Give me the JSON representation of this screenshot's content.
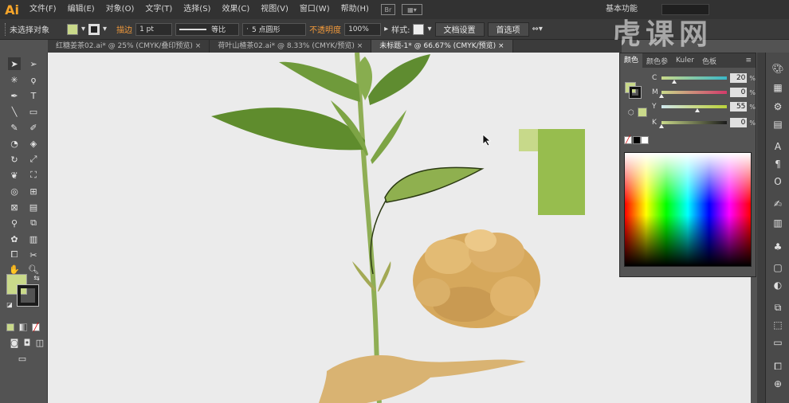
{
  "app": {
    "logo": "Ai"
  },
  "menu": [
    "文件(F)",
    "编辑(E)",
    "对象(O)",
    "文字(T)",
    "选择(S)",
    "效果(C)",
    "视图(V)",
    "窗口(W)",
    "帮助(H)"
  ],
  "menu_extra": {
    "bridge": "Br"
  },
  "workspace": "基本功能",
  "watermark": "虎课网",
  "control_bar": {
    "selection": "未选择对象",
    "fill_color": "#c9d98a",
    "stroke_label": "描边",
    "stroke_weight": "1 pt",
    "stroke_profile": "等比",
    "brush": "5 点圆形",
    "opacity_label": "不透明度",
    "opacity_value": "100%",
    "style_label": "样式:",
    "doc_setup": "文档设置",
    "preferences": "首选项"
  },
  "tabs": [
    {
      "label": "红糖姜茶02.ai* @ 25% (CMYK/叠印预览)",
      "active": false
    },
    {
      "label": "荷叶山楂茶02.ai* @ 8.33% (CMYK/预览)",
      "active": false
    },
    {
      "label": "未标题-1* @ 66.67% (CMYK/预览)",
      "active": true
    }
  ],
  "color_panel": {
    "tabs": [
      "颜色",
      "颜色参",
      "Kuler",
      "色板"
    ],
    "active_tab": "颜色",
    "sliders": [
      {
        "label": "C",
        "value": "20",
        "fraction": 0.2
      },
      {
        "label": "M",
        "value": "0",
        "fraction": 0.0
      },
      {
        "label": "Y",
        "value": "55",
        "fraction": 0.55
      },
      {
        "label": "K",
        "value": "0",
        "fraction": 0.0
      }
    ],
    "percent": "%"
  },
  "canvas": {
    "light_green": "#c7d98a",
    "dark_green": "#97bd4e",
    "background": "#ebebeb"
  }
}
